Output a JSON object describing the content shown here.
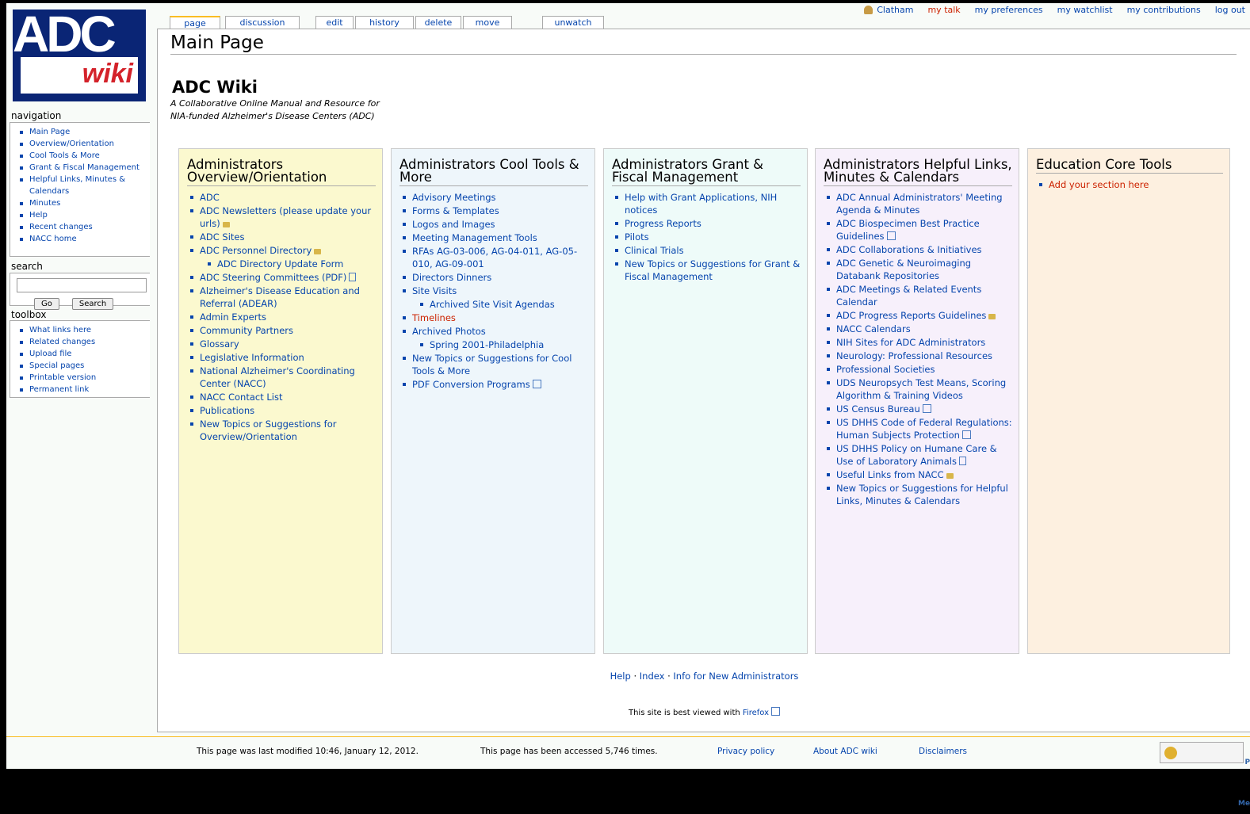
{
  "personal": {
    "user": "Clatham",
    "talk": "my talk",
    "prefs": "my preferences",
    "watch": "my watchlist",
    "contribs": "my contributions",
    "logout": "log out"
  },
  "logo": {
    "top": "ADC",
    "bottom": "wiki"
  },
  "tabs": [
    "page",
    "discussion",
    "edit",
    "history",
    "delete",
    "move",
    "unwatch"
  ],
  "page_title": "Main Page",
  "wiki_title": "ADC Wiki",
  "wiki_subtitle_1": "A Collaborative Online Manual and Resource for",
  "wiki_subtitle_2": "NIA-funded Alzheimer's Disease Centers (ADC)",
  "nav": {
    "heading": "navigation",
    "items": [
      "Main Page",
      "Overview/Orientation",
      "Cool Tools & More",
      "Grant & Fiscal Management",
      "Helpful Links, Minutes & Calendars",
      "Minutes",
      "Help",
      "Recent changes",
      "NACC home"
    ]
  },
  "search": {
    "heading": "search",
    "go": "Go",
    "search": "Search"
  },
  "toolbox": {
    "heading": "toolbox",
    "items": [
      "What links here",
      "Related changes",
      "Upload file",
      "Special pages",
      "Printable version",
      "Permanent link"
    ]
  },
  "columns": [
    {
      "title": "Administrators Overview/Orientation",
      "bg": "#fbf9cf",
      "items": [
        {
          "t": "ADC"
        },
        {
          "t": "ADC Newsletters (please update your urls)",
          "icon": "lock"
        },
        {
          "t": "ADC Sites"
        },
        {
          "t": "ADC Personnel Directory",
          "icon": "lock"
        },
        {
          "t": "ADC Directory Update Form",
          "sub": true
        },
        {
          "t": "ADC Steering Committees (PDF)",
          "icon": "pdf"
        },
        {
          "t": "Alzheimer's Disease Education and Referral (ADEAR)"
        },
        {
          "t": "Admin Experts"
        },
        {
          "t": "Community Partners"
        },
        {
          "t": "Glossary"
        },
        {
          "t": "Legislative Information"
        },
        {
          "t": "National Alzheimer's Coordinating Center (NACC)"
        },
        {
          "t": "NACC Contact List"
        },
        {
          "t": "Publications"
        },
        {
          "t": "New Topics or Suggestions for Overview/Orientation"
        }
      ]
    },
    {
      "title": "Administrators Cool Tools & More",
      "bg": "#eef6fb",
      "items": [
        {
          "t": "Advisory Meetings"
        },
        {
          "t": "Forms & Templates"
        },
        {
          "t": "Logos and Images"
        },
        {
          "t": "Meeting Management Tools"
        },
        {
          "t": "RFAs AG-03-006, AG-04-011, AG-05-010, AG-09-001"
        },
        {
          "t": "Directors Dinners"
        },
        {
          "t": "Site Visits"
        },
        {
          "t": "Archived Site Visit Agendas",
          "sub": true
        },
        {
          "t": "Timelines",
          "red": true
        },
        {
          "t": "Archived Photos"
        },
        {
          "t": "Spring 2001-Philadelphia",
          "sub": true
        },
        {
          "t": "New Topics or Suggestions for Cool Tools & More"
        },
        {
          "t": "PDF Conversion Programs",
          "icon": "ext"
        }
      ]
    },
    {
      "title": "Administrators Grant & Fiscal Management",
      "bg": "#eefbf9",
      "items": [
        {
          "t": "Help with Grant Applications, NIH notices"
        },
        {
          "t": "Progress Reports"
        },
        {
          "t": "Pilots"
        },
        {
          "t": "Clinical Trials"
        },
        {
          "t": "New Topics or Suggestions for Grant & Fiscal Management"
        }
      ]
    },
    {
      "title": "Administrators Helpful Links, Minutes & Calendars",
      "bg": "#f7f0fb",
      "items": [
        {
          "t": "ADC Annual Administrators' Meeting Agenda & Minutes"
        },
        {
          "t": "ADC Biospecimen Best Practice Guidelines",
          "icon": "ext"
        },
        {
          "t": "ADC Collaborations & Initiatives"
        },
        {
          "t": "ADC Genetic & Neuroimaging Databank Repositories"
        },
        {
          "t": "ADC Meetings & Related Events Calendar"
        },
        {
          "t": "ADC Progress Reports Guidelines",
          "icon": "lock"
        },
        {
          "t": "NACC Calendars"
        },
        {
          "t": "NIH Sites for ADC Administrators"
        },
        {
          "t": "Neurology: Professional Resources"
        },
        {
          "t": "Professional Societies"
        },
        {
          "t": "UDS Neuropsych Test Means, Scoring Algorithm & Training Videos"
        },
        {
          "t": "US Census Bureau",
          "icon": "ext"
        },
        {
          "t": "US DHHS Code of Federal Regulations: Human Subjects Protection",
          "icon": "ext"
        },
        {
          "t": "US DHHS Policy on Humane Care & Use of Laboratory Animals",
          "icon": "pdf"
        },
        {
          "t": "Useful Links from NACC",
          "icon": "lock"
        },
        {
          "t": "New Topics or Suggestions for Helpful Links, Minutes & Calendars"
        }
      ]
    },
    {
      "title": "Education Core Tools",
      "bg": "#fdf0e0",
      "items": [
        {
          "t": "Add your section here",
          "red": true
        }
      ]
    }
  ],
  "bottom": {
    "help": "Help",
    "index": "Index",
    "info": "Info for New Administrators",
    "sep": "·",
    "ff_pre": "This site is best viewed with",
    "ff": "Firefox"
  },
  "footer": {
    "modified": "This page was last modified 10:46, January 12, 2012.",
    "accessed": "This page has been accessed 5,746 times.",
    "privacy": "Privacy policy",
    "about": "About ADC wiki",
    "disclaimers": "Disclaimers",
    "powered": "Powered By MediaWiki"
  }
}
